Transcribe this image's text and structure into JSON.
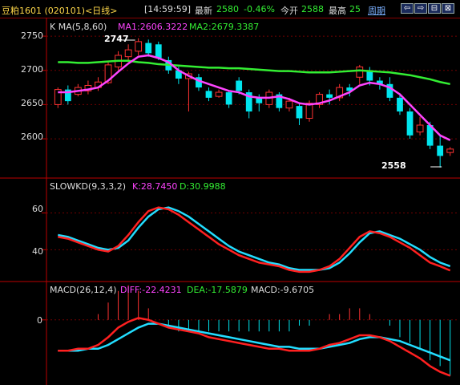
{
  "header": {
    "title": "豆粕1601 (020101)<日线>",
    "time": "[14:59:59]",
    "latest_label": "最新",
    "latest_value": "2580",
    "change_pct": "-0.46%",
    "open_label": "今开",
    "open_value": "2588",
    "high_label": "最高",
    "high_value": "25",
    "period_link": "周期",
    "nav_buttons": [
      "⇦",
      "⇨",
      "⊟",
      "⊠"
    ]
  },
  "colors": {
    "up": "#ff3232",
    "down": "#00e5ee",
    "ma1": "#ff44ff",
    "ma2": "#33ee33",
    "k_line": "#ff2020",
    "d_line": "#22ddff",
    "grid": "#700000"
  },
  "price_panel": {
    "title": "K  MA(5,8,60)",
    "ma1_label": "MA1:2606.3222",
    "ma2_label": "MA2:2679.3387",
    "y_ticks": [
      "2750",
      "2700",
      "2650",
      "2600"
    ],
    "high_marker": "2747",
    "low_marker": "2558"
  },
  "kd_panel": {
    "title": "SLOWKD(9,3,3,2)",
    "k_label": "K:28.7450",
    "d_label": "D:30.9988",
    "y_ticks": [
      "60",
      "40"
    ]
  },
  "macd_panel": {
    "title": "MACD(26,12,4)",
    "diff_label": "DIFF:-22.4231",
    "dea_label": "DEA:-17.5879",
    "macd_label": "MACD:-9.6705",
    "y_ticks": [
      "0"
    ]
  },
  "chart_data": [
    {
      "type": "candlestick",
      "title": "K  MA(5,8,60)",
      "ylim": [
        2545,
        2770
      ],
      "candles": [
        [
          2650,
          2672,
          2645,
          2675
        ],
        [
          2672,
          2655,
          2650,
          2678
        ],
        [
          2665,
          2675,
          2662,
          2680
        ],
        [
          2670,
          2678,
          2665,
          2685
        ],
        [
          2675,
          2683,
          2670,
          2690
        ],
        [
          2682,
          2708,
          2680,
          2712
        ],
        [
          2705,
          2722,
          2700,
          2728
        ],
        [
          2720,
          2730,
          2712,
          2738
        ],
        [
          2728,
          2742,
          2722,
          2747
        ],
        [
          2740,
          2725,
          2720,
          2745
        ],
        [
          2738,
          2718,
          2715,
          2742
        ],
        [
          2715,
          2700,
          2695,
          2720
        ],
        [
          2700,
          2688,
          2680,
          2705
        ],
        [
          2688,
          2695,
          2640,
          2698
        ],
        [
          2690,
          2675,
          2670,
          2695
        ],
        [
          2670,
          2660,
          2655,
          2675
        ],
        [
          2662,
          2668,
          2660,
          2672
        ],
        [
          2668,
          2650,
          2645,
          2670
        ],
        [
          2685,
          2670,
          2665,
          2690
        ],
        [
          2668,
          2640,
          2630,
          2672
        ],
        [
          2660,
          2652,
          2640,
          2665
        ],
        [
          2650,
          2668,
          2645,
          2672
        ],
        [
          2665,
          2645,
          2640,
          2668
        ],
        [
          2645,
          2655,
          2640,
          2660
        ],
        [
          2648,
          2630,
          2620,
          2652
        ],
        [
          2630,
          2652,
          2625,
          2656
        ],
        [
          2650,
          2665,
          2645,
          2668
        ],
        [
          2665,
          2660,
          2650,
          2672
        ],
        [
          2660,
          2675,
          2655,
          2680
        ],
        [
          2675,
          2670,
          2662,
          2680
        ],
        [
          2690,
          2705,
          2680,
          2708
        ],
        [
          2700,
          2685,
          2678,
          2705
        ],
        [
          2685,
          2680,
          2672,
          2690
        ],
        [
          2680,
          2660,
          2655,
          2690
        ],
        [
          2660,
          2640,
          2635,
          2665
        ],
        [
          2640,
          2605,
          2600,
          2645
        ],
        [
          2610,
          2620,
          2605,
          2632
        ],
        [
          2620,
          2590,
          2585,
          2625
        ],
        [
          2590,
          2575,
          2558,
          2605
        ],
        [
          2580,
          2585,
          2575,
          2588
        ]
      ],
      "ma1": [
        2668,
        2668,
        2670,
        2672,
        2675,
        2685,
        2698,
        2710,
        2720,
        2722,
        2718,
        2712,
        2700,
        2692,
        2685,
        2680,
        2675,
        2670,
        2668,
        2662,
        2660,
        2660,
        2662,
        2658,
        2652,
        2650,
        2652,
        2656,
        2662,
        2668,
        2678,
        2682,
        2680,
        2675,
        2665,
        2650,
        2635,
        2620,
        2605,
        2598
      ],
      "ma2": [
        2712,
        2712,
        2711,
        2711,
        2712,
        2713,
        2714,
        2714,
        2712,
        2711,
        2709,
        2708,
        2707,
        2706,
        2705,
        2704,
        2704,
        2703,
        2703,
        2702,
        2701,
        2700,
        2699,
        2699,
        2698,
        2697,
        2697,
        2697,
        2698,
        2699,
        2700,
        2699,
        2698,
        2697,
        2695,
        2693,
        2690,
        2687,
        2683,
        2680
      ]
    },
    {
      "type": "line",
      "title": "SLOWKD(9,3,3,2)",
      "ylim": [
        24,
        72
      ],
      "series": [
        {
          "name": "K",
          "values": [
            47,
            46,
            44,
            42,
            40,
            39,
            42,
            48,
            55,
            61,
            63,
            62,
            59,
            55,
            51,
            47,
            43,
            40,
            37,
            35,
            33,
            32,
            31,
            29,
            28,
            28,
            29,
            31,
            35,
            41,
            47,
            50,
            49,
            47,
            44,
            41,
            37,
            33,
            31,
            28.7
          ]
        },
        {
          "name": "D",
          "values": [
            48,
            47,
            45,
            43,
            41,
            40,
            41,
            45,
            52,
            58,
            62,
            63,
            61,
            58,
            54,
            50,
            46,
            42,
            39,
            37,
            35,
            33,
            32,
            30,
            29,
            29,
            29,
            30,
            33,
            38,
            44,
            49,
            50,
            48,
            46,
            43,
            40,
            36,
            33,
            31
          ]
        }
      ]
    },
    {
      "type": "line",
      "title": "MACD(26,12,4)",
      "ylim": [
        -33,
        12
      ],
      "series": [
        {
          "name": "DIFF",
          "values": [
            -16,
            -16,
            -15,
            -15,
            -13,
            -9,
            -4,
            -1,
            1,
            0,
            -2,
            -4,
            -5,
            -6,
            -7,
            -9,
            -10,
            -11,
            -12,
            -13,
            -14,
            -15,
            -15,
            -16,
            -16,
            -16,
            -15,
            -13,
            -12,
            -10,
            -8,
            -8,
            -9,
            -11,
            -14,
            -17,
            -20,
            -24,
            -27,
            -29
          ]
        },
        {
          "name": "DEA",
          "values": [
            -16,
            -16,
            -16,
            -15,
            -15,
            -13,
            -10,
            -7,
            -4,
            -2,
            -2,
            -3,
            -4,
            -5,
            -6,
            -7,
            -8,
            -9,
            -10,
            -11,
            -12,
            -13,
            -14,
            -14,
            -15,
            -15,
            -15,
            -14,
            -13,
            -12,
            -10,
            -9,
            -9,
            -10,
            -11,
            -13,
            -15,
            -17,
            -19,
            -21
          ]
        },
        {
          "name": "MACD",
          "values": [
            0,
            0,
            0,
            0,
            1,
            3,
            5,
            6,
            5,
            2,
            0,
            -1,
            -2,
            -2,
            -2,
            -2,
            -2,
            -2,
            -2,
            -2,
            -2,
            -2,
            -2,
            -2,
            -1,
            -1,
            0,
            1,
            1,
            2,
            2,
            1,
            0,
            -1,
            -3,
            -4,
            -5,
            -7,
            -8,
            -9.7
          ]
        }
      ]
    }
  ]
}
